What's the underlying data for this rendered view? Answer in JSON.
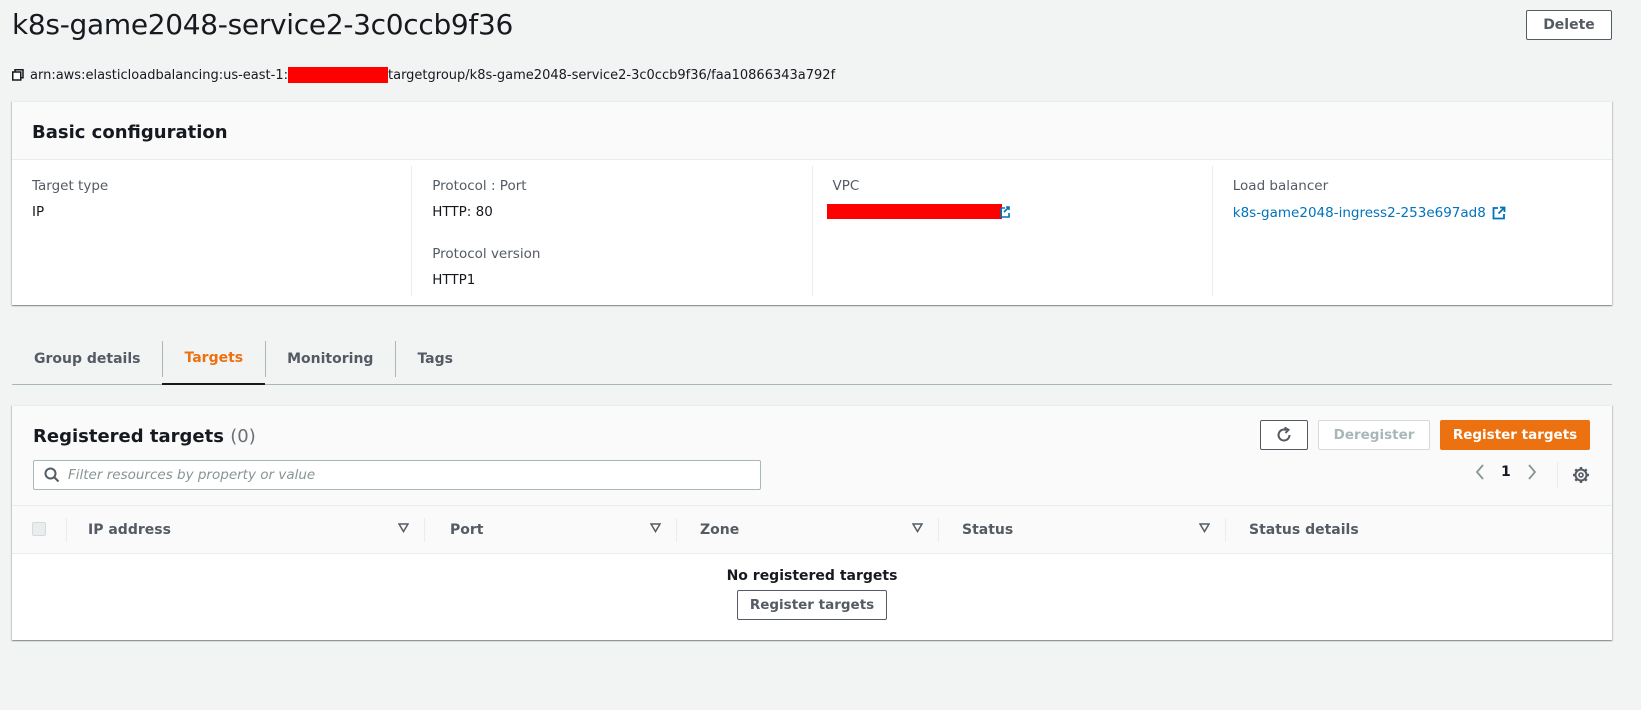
{
  "header": {
    "title": "k8s-game2048-service2-3c0ccb9f36",
    "delete_label": "Delete",
    "arn_prefix": "arn:aws:elasticloadbalancing:us-east-1:",
    "arn_suffix": "targetgroup/k8s-game2048-service2-3c0ccb9f36/faa10866343a792f"
  },
  "basic_config": {
    "title": "Basic configuration",
    "target_type_label": "Target type",
    "target_type_value": "IP",
    "protocol_port_label": "Protocol : Port",
    "protocol_port_value": "HTTP: 80",
    "protocol_version_label": "Protocol version",
    "protocol_version_value": "HTTP1",
    "vpc_label": "VPC",
    "load_balancer_label": "Load balancer",
    "load_balancer_value": "k8s-game2048-ingress2-253e697ad8"
  },
  "tabs": [
    {
      "label": "Group details",
      "active": false
    },
    {
      "label": "Targets",
      "active": true
    },
    {
      "label": "Monitoring",
      "active": false
    },
    {
      "label": "Tags",
      "active": false
    }
  ],
  "targets": {
    "title": "Registered targets",
    "count": "(0)",
    "deregister_label": "Deregister",
    "register_label": "Register targets",
    "filter_placeholder": "Filter resources by property or value",
    "page": "1",
    "columns": [
      "IP address",
      "Port",
      "Zone",
      "Status",
      "Status details"
    ],
    "empty_text": "No registered targets",
    "empty_button": "Register targets"
  },
  "colors": {
    "accent_orange": "#ec7211",
    "link_blue": "#0073bb",
    "redaction": "#ff0000"
  }
}
